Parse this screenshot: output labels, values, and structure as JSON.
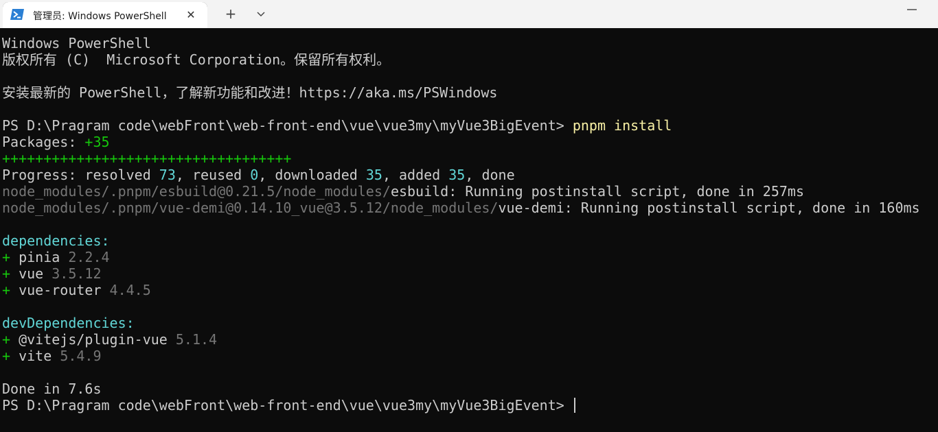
{
  "window": {
    "tab_title": "管理员: Windows PowerShell",
    "icons": {
      "tab": "powershell-icon",
      "close": "close-icon",
      "new_tab": "plus-icon",
      "dropdown": "chevron-down-icon",
      "minimize": "minimize-icon"
    }
  },
  "colors": {
    "background": "#0c0c0c",
    "foreground": "#cccccc",
    "command": "#f9f1a5",
    "green": "#16c60c",
    "cyan": "#61d6d6",
    "gray": "#767676"
  },
  "terminal": {
    "banner_title": "Windows PowerShell",
    "copyright": "版权所有 (C)  Microsoft Corporation。保留所有权利。",
    "upgrade_notice": "安装最新的 PowerShell，了解新功能和改进！https://aka.ms/PSWindows",
    "prompt": "PS D:\\Pragram code\\webFront\\web-front-end\\vue\\vue3my\\myVue3BigEvent> ",
    "command": "pnpm install",
    "packages_label": "Packages: ",
    "packages_count": "+35",
    "progress_bar": "+++++++++++++++++++++++++++++++++++",
    "progress": {
      "prefix": "Progress: resolved ",
      "resolved": "73",
      "reused_label": ", reused ",
      "reused": "0",
      "downloaded_label": ", downloaded ",
      "downloaded": "35",
      "added_label": ", added ",
      "added": "35",
      "suffix": ", done"
    },
    "postinstall": [
      {
        "path": "node_modules/.pnpm/esbuild@0.21.5/node_modules/",
        "pkg": "esbuild",
        "message": ": Running postinstall script, done in 257ms"
      },
      {
        "path": "node_modules/.pnpm/vue-demi@0.14.10_vue@3.5.12/node_modules/",
        "pkg": "vue-demi",
        "message": ": Running postinstall script, done in 160ms"
      }
    ],
    "dependencies_header": "dependencies:",
    "dependencies": [
      {
        "plus": "+ ",
        "name": "pinia ",
        "version": "2.2.4"
      },
      {
        "plus": "+ ",
        "name": "vue ",
        "version": "3.5.12"
      },
      {
        "plus": "+ ",
        "name": "vue-router ",
        "version": "4.4.5"
      }
    ],
    "dev_dependencies_header": "devDependencies:",
    "dev_dependencies": [
      {
        "plus": "+ ",
        "name": "@vitejs/plugin-vue ",
        "version": "5.1.4"
      },
      {
        "plus": "+ ",
        "name": "vite ",
        "version": "5.4.9"
      }
    ],
    "done": "Done in 7.6s",
    "final_prompt": "PS D:\\Pragram code\\webFront\\web-front-end\\vue\\vue3my\\myVue3BigEvent> "
  }
}
